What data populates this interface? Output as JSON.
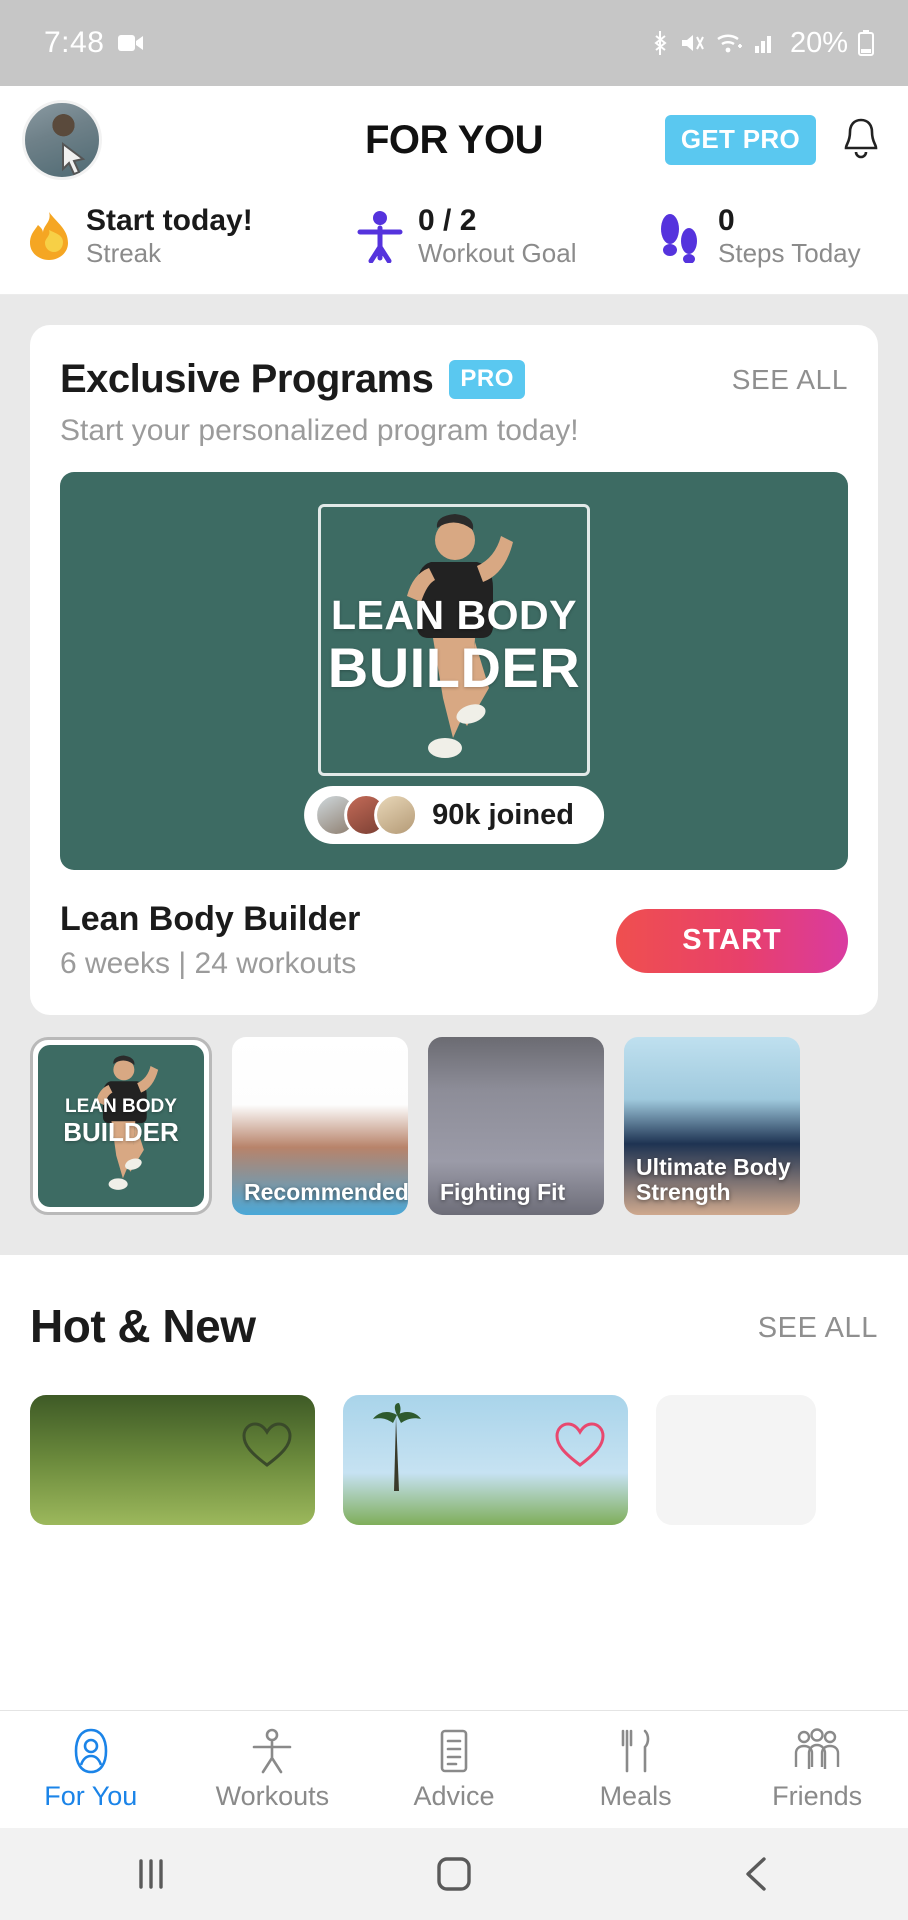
{
  "status_bar": {
    "time": "7:48",
    "battery_percent": "20%",
    "icons": [
      "screen-record-icon",
      "bluetooth-icon",
      "mute-icon",
      "wifi-icon",
      "signal-icon",
      "battery-icon"
    ]
  },
  "header": {
    "title": "FOR YOU",
    "get_pro_label": "GET PRO",
    "avatar_name": "user-avatar",
    "bell_name": "notifications-bell-icon"
  },
  "stats": [
    {
      "icon": "flame-icon",
      "value": "Start today!",
      "label": "Streak"
    },
    {
      "icon": "person-stretch-icon",
      "value": "0 / 2",
      "label": "Workout Goal"
    },
    {
      "icon": "footsteps-icon",
      "value": "0",
      "label": "Steps Today"
    }
  ],
  "exclusive": {
    "title": "Exclusive Programs",
    "pro_badge": "PRO",
    "see_all": "SEE ALL",
    "subtitle": "Start your personalized program today!",
    "hero": {
      "line1": "LEAN BODY",
      "line2": "BUILDER",
      "joined": "90k joined"
    },
    "program_name": "Lean Body Builder",
    "program_meta": "6 weeks | 24 workouts",
    "start_label": "START"
  },
  "thumbnails": [
    {
      "label_line1": "LEAN BODY",
      "label_line2": "BUILDER",
      "selected": true
    },
    {
      "label": "Recommended",
      "selected": false
    },
    {
      "label": "Fighting Fit",
      "selected": false
    },
    {
      "label": "Ultimate Body Strength",
      "selected": false
    }
  ],
  "hot_new": {
    "title": "Hot & New",
    "see_all": "SEE ALL"
  },
  "bottom_nav": [
    {
      "label": "For You",
      "icon": "person-circle-icon",
      "active": true
    },
    {
      "label": "Workouts",
      "icon": "stretching-person-icon",
      "active": false
    },
    {
      "label": "Advice",
      "icon": "document-lines-icon",
      "active": false
    },
    {
      "label": "Meals",
      "icon": "fork-knife-icon",
      "active": false
    },
    {
      "label": "Friends",
      "icon": "people-group-icon",
      "active": false
    }
  ],
  "system_nav": [
    "recents-icon",
    "home-icon",
    "back-icon"
  ],
  "colors": {
    "accent_blue": "#1b84e8",
    "pro_cyan": "#5ac8f0",
    "hero_teal": "#3d6b63",
    "start_gradient_from": "#ef4f4f",
    "start_gradient_to": "#d93ba0",
    "status_bar": "#c6c6c6"
  }
}
